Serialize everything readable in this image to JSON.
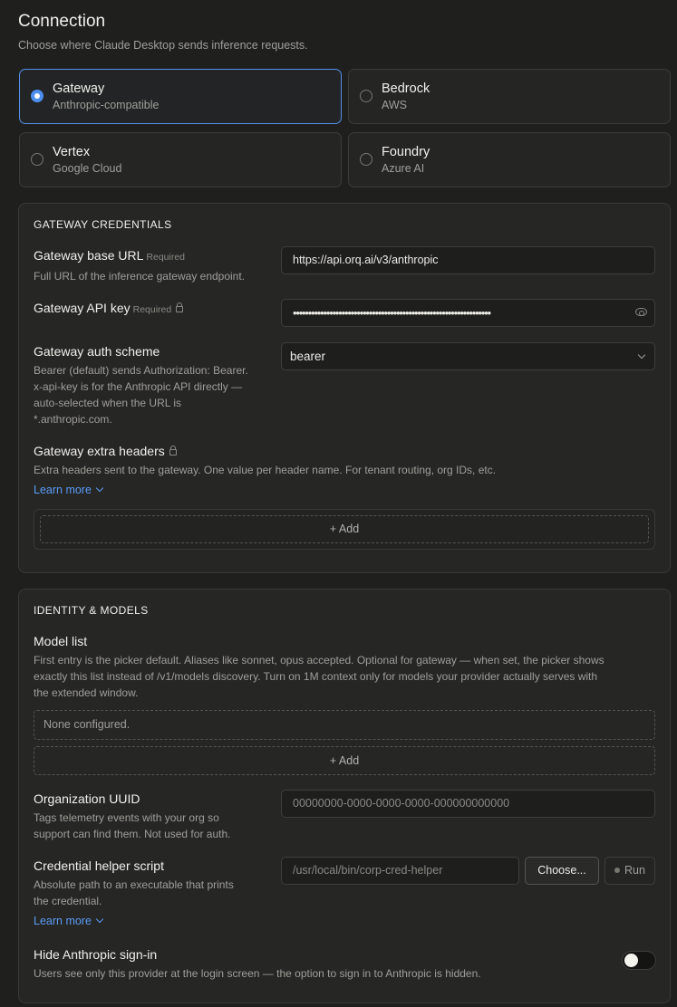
{
  "connection": {
    "title": "Connection",
    "subtitle": "Choose where Claude Desktop sends inference requests.",
    "providers": [
      {
        "name": "Gateway",
        "sub": "Anthropic-compatible",
        "selected": true
      },
      {
        "name": "Bedrock",
        "sub": "AWS",
        "selected": false
      },
      {
        "name": "Vertex",
        "sub": "Google Cloud",
        "selected": false
      },
      {
        "name": "Foundry",
        "sub": "Azure AI",
        "selected": false
      }
    ]
  },
  "gateway": {
    "section_title": "GATEWAY CREDENTIALS",
    "base_url": {
      "label": "Gateway base URL",
      "required": "Required",
      "help": "Full URL of the inference gateway endpoint.",
      "value": "https://api.orq.ai/v3/anthropic"
    },
    "api_key": {
      "label": "Gateway API key",
      "required": "Required",
      "value": "•••••••••••••••••••••••••••••••••••••••••••••••••••••••••••••••••"
    },
    "auth_scheme": {
      "label": "Gateway auth scheme",
      "help_lines": [
        "Bearer (default) sends Authorization: Bearer.",
        "x-api-key is for the Anthropic API directly —",
        "auto-selected when the URL is",
        "*.anthropic.com."
      ],
      "value": "bearer"
    },
    "extra_headers": {
      "label": "Gateway extra headers",
      "help": "Extra headers sent to the gateway. One value per header name. For tenant routing, org IDs, etc.",
      "learn_more": "Learn more",
      "add_label": "+ Add"
    }
  },
  "identity": {
    "section_title": "IDENTITY & MODELS",
    "model_list": {
      "label": "Model list",
      "help_lines": [
        "First entry is the picker default. Aliases like sonnet, opus accepted. Optional for gateway — when set, the picker shows",
        "exactly this list instead of /v1/models discovery. Turn on 1M context only for models your provider actually serves with",
        "the extended window."
      ],
      "empty_text": "None configured.",
      "add_label": "+ Add"
    },
    "org_uuid": {
      "label": "Organization UUID",
      "help_lines": [
        "Tags telemetry events with your org so",
        "support can find them. Not used for auth."
      ],
      "placeholder": "00000000-0000-0000-0000-000000000000"
    },
    "cred_helper": {
      "label": "Credential helper script",
      "help_lines": [
        "Absolute path to an executable that prints",
        "the credential."
      ],
      "placeholder": "/usr/local/bin/corp-cred-helper",
      "choose_label": "Choose...",
      "run_label": "Run",
      "learn_more": "Learn more"
    },
    "hide_signin": {
      "label": "Hide Anthropic sign-in",
      "help": "Users see only this provider at the login screen — the option to sign in to Anthropic is hidden.",
      "enabled": false
    }
  }
}
